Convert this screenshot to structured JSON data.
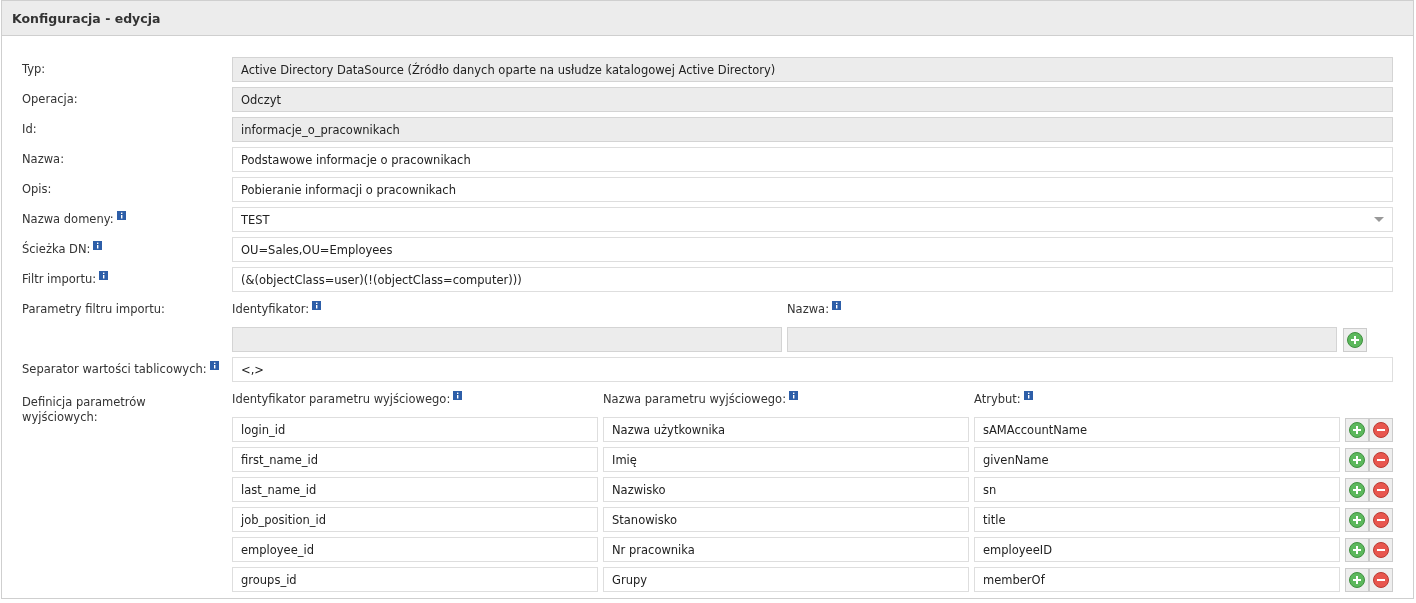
{
  "panel": {
    "title": "Konfiguracja - edycja"
  },
  "fields": [
    {
      "label": "Typ:",
      "info": false,
      "kind": "text",
      "readonly": true,
      "value": "Active Directory DataSource (Źródło danych oparte na usłudze katalogowej Active Directory)"
    },
    {
      "label": "Operacja:",
      "info": false,
      "kind": "text",
      "readonly": true,
      "value": "Odczyt"
    },
    {
      "label": "Id:",
      "info": false,
      "kind": "text",
      "readonly": true,
      "value": "informacje_o_pracownikach"
    },
    {
      "label": "Nazwa:",
      "info": false,
      "kind": "text",
      "readonly": false,
      "value": "Podstawowe informacje o pracownikach"
    },
    {
      "label": "Opis:",
      "info": false,
      "kind": "text",
      "readonly": false,
      "value": "Pobieranie informacji o pracownikach"
    },
    {
      "label": "Nazwa domeny:",
      "info": true,
      "kind": "select",
      "readonly": false,
      "value": "TEST"
    },
    {
      "label": "Ścieżka DN:",
      "info": true,
      "kind": "text",
      "readonly": false,
      "value": "OU=Sales,OU=Employees"
    },
    {
      "label": "Filtr importu:",
      "info": true,
      "kind": "text",
      "readonly": false,
      "value": "(&(objectClass=user)(!(objectClass=computer)))"
    }
  ],
  "filter_params": {
    "label": "Parametry filtru importu:",
    "columns": [
      {
        "label": "Identyfikator:",
        "info": true
      },
      {
        "label": "Nazwa:",
        "info": true
      }
    ],
    "rows": [
      {
        "readonly": [
          true,
          true
        ]
      }
    ]
  },
  "separator": {
    "label": "Separator wartości tablicowych:",
    "info": true,
    "kind": "text",
    "readonly": false,
    "value": "<,>"
  },
  "output_params": {
    "label": "Definicja parametrów wyjściowych:",
    "columns": [
      {
        "label": "Identyfikator parametru wyjściowego:",
        "info": true
      },
      {
        "label": "Nazwa parametru wyjściowego:",
        "info": true
      },
      {
        "label": "Atrybut:",
        "info": true
      }
    ],
    "rows": [
      {
        "cells": [
          "login_id",
          "Nazwa użytkownika",
          "sAMAccountName"
        ]
      },
      {
        "cells": [
          "first_name_id",
          "Imię",
          "givenName"
        ]
      },
      {
        "cells": [
          "last_name_id",
          "Nazwisko",
          "sn"
        ]
      },
      {
        "cells": [
          "job_position_id",
          "Stanowisko",
          "title"
        ]
      },
      {
        "cells": [
          "employee_id",
          "Nr pracownika",
          "employeeID"
        ]
      },
      {
        "cells": [
          "groups_id",
          "Grupy",
          "memberOf"
        ]
      }
    ]
  }
}
